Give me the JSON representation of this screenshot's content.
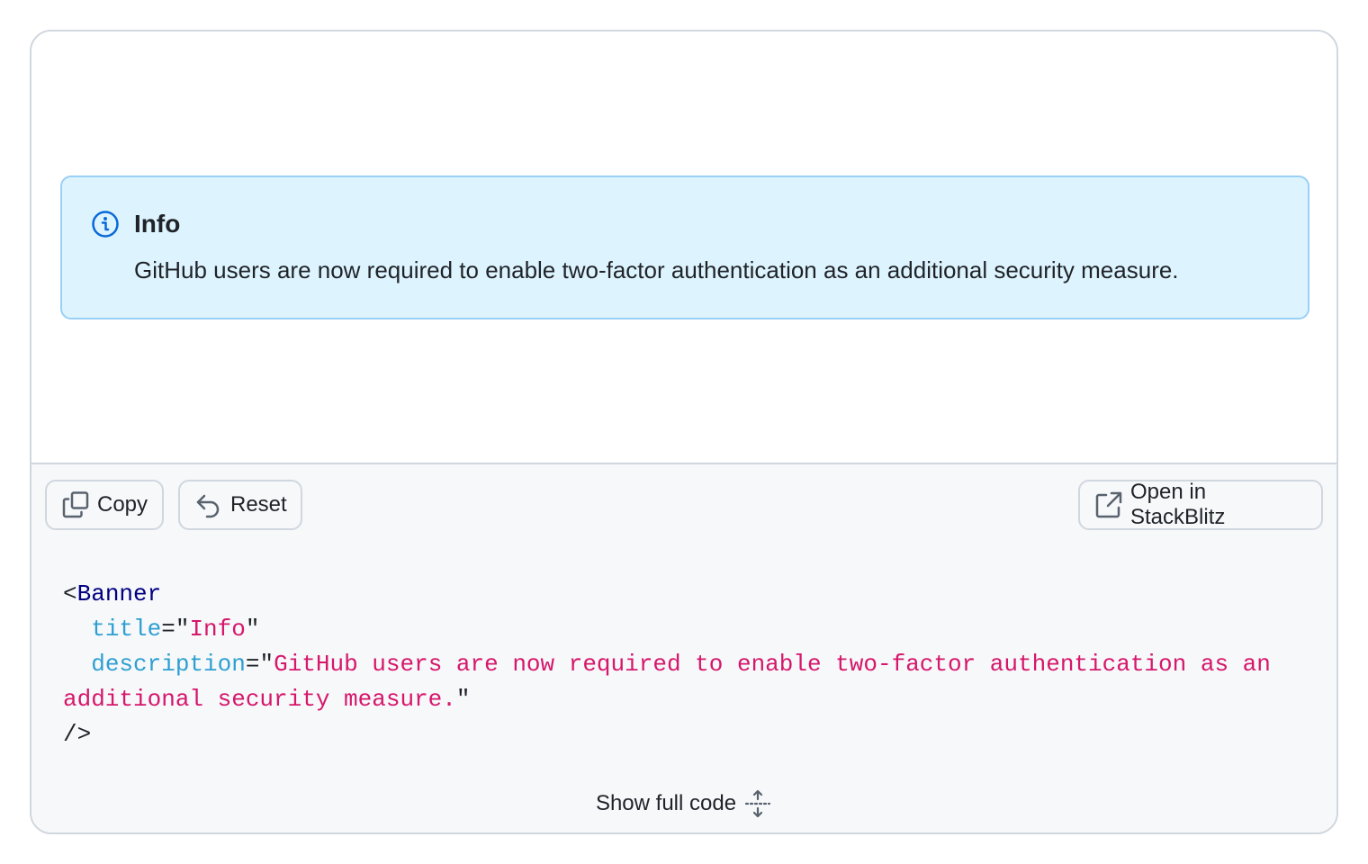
{
  "banner": {
    "variant": "info",
    "icon": "info-icon",
    "title": "Info",
    "description": "GitHub users are now required to enable two-factor authentication as an additional security measure."
  },
  "toolbar": {
    "copy_label": "Copy",
    "reset_label": "Reset",
    "stackblitz_label": "Open in StackBlitz"
  },
  "code": {
    "open": "<",
    "component": "Banner",
    "attr_title": "title",
    "eq": "=",
    "quote": "\"",
    "title_value": "Info",
    "attr_description": "description",
    "description_value": "GitHub users are now required to enable two-factor authentication as an additional security measure.",
    "close": "/>"
  },
  "footer": {
    "show_full_code_label": "Show full code"
  },
  "colors": {
    "banner_bg": "#ddf4ff",
    "banner_border": "#9ad0f5",
    "info_icon": "#0969da",
    "code_tag": "#000080",
    "code_attr": "#2e9fd2",
    "code_string": "#d6176b"
  }
}
